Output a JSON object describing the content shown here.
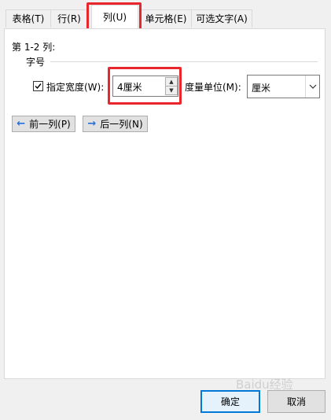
{
  "tabs": [
    {
      "label": "表格(T)"
    },
    {
      "label": "行(R)"
    },
    {
      "label": "列(U)"
    },
    {
      "label": "单元格(E)"
    },
    {
      "label": "可选文字(A)"
    }
  ],
  "column_section": {
    "title": "第 1-2 列:",
    "group_label": "字号",
    "specify_width_label": "指定宽度(W):",
    "specify_width_checked": true,
    "width_value": "4厘米",
    "measure_unit_label": "度量单位(M):",
    "measure_unit_value": "厘米"
  },
  "nav_buttons": {
    "prev_label": "前一列(P)",
    "next_label": "后一列(N)"
  },
  "footer": {
    "ok_label": "确定",
    "cancel_label": "取消"
  },
  "watermark_text": "Baidu经验",
  "colors": {
    "highlight": "#e8262b",
    "accent": "#0078d7"
  }
}
